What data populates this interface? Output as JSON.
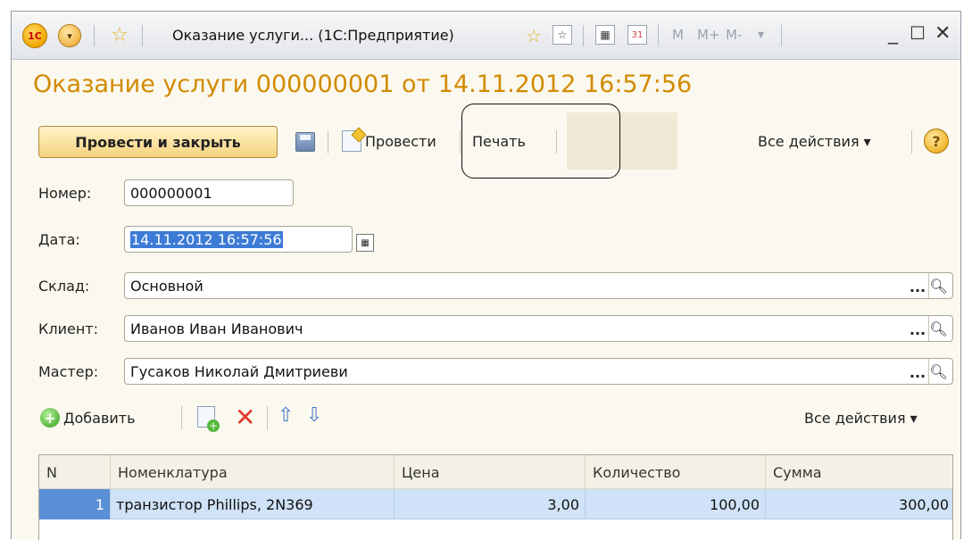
{
  "window": {
    "title": "Оказание услуги... (1С:Предприятие)",
    "logo_text": "1С",
    "memory_buttons": [
      "M",
      "M+",
      "M-"
    ]
  },
  "document": {
    "title": "Оказание услуги 000000001 от 14.11.2012 16:57:56"
  },
  "toolbar": {
    "post_and_close": "Провести и закрыть",
    "post": "Провести",
    "print": "Печать",
    "all_actions": "Все действия ▾",
    "help": "?"
  },
  "fields": {
    "number_label": "Номер:",
    "number_value": "000000001",
    "date_label": "Дата:",
    "date_value": "14.11.2012 16:57:56",
    "warehouse_label": "Склад:",
    "warehouse_value": "Основной",
    "client_label": "Клиент:",
    "client_value": "Иванов Иван Иванович",
    "master_label": "Мастер:",
    "master_value": "Гусаков Николай Дмитриеви"
  },
  "table_toolbar": {
    "add": "Добавить",
    "all_actions": "Все действия ▾"
  },
  "table": {
    "columns": [
      "N",
      "Номенклатура",
      "Цена",
      "Количество",
      "Сумма"
    ],
    "rows": [
      {
        "n": "1",
        "item": "транзистор Phillips, 2N369",
        "price": "3,00",
        "qty": "100,00",
        "sum": "300,00"
      }
    ]
  },
  "colors": {
    "accent_title": "#d28a00",
    "row_selected": "#cfe2f7"
  }
}
